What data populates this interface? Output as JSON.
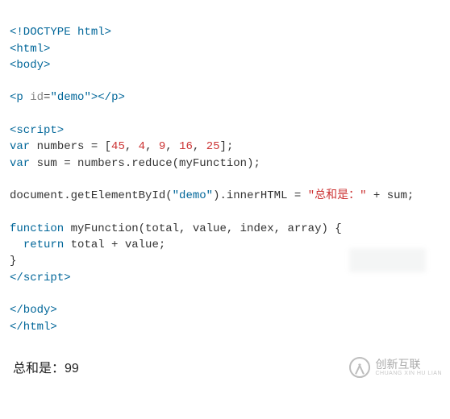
{
  "code": {
    "line1": {
      "open": "<!DOCTYPE",
      "rest": " html>"
    },
    "line2": {
      "open": "<html>"
    },
    "line3": {
      "open": "<body>"
    },
    "blank4": "",
    "line5": {
      "open": "<p ",
      "attr": "id",
      "eq": "=",
      "val": "\"demo\"",
      "mid": ">",
      "close": "</p>"
    },
    "blank6": "",
    "line7": {
      "open": "<script>"
    },
    "line8": {
      "kw": "var",
      "lhs": " numbers = [",
      "n1": "45",
      "c1": ", ",
      "n2": "4",
      "c2": ", ",
      "n3": "9",
      "c3": ", ",
      "n4": "16",
      "c4": ", ",
      "n5": "25",
      "tail": "];"
    },
    "line9": {
      "kw": "var",
      "rest": " sum = numbers.reduce(myFunction);"
    },
    "blank10": "",
    "line11": {
      "pre": "document.getElementById(",
      "arg": "\"demo\"",
      "mid": ").innerHTML = ",
      "lit": "\"总和是：\"",
      "post": " + sum;"
    },
    "blank12": "",
    "line13": {
      "kw": "function",
      "rest": " myFunction(total, value, index, array) {"
    },
    "line14": {
      "indent": "  ",
      "kw": "return",
      "rest": " total + value;"
    },
    "line15": {
      "brace": "}"
    },
    "line16": {
      "close": "</",
      "name": "script",
      "gt": ">"
    },
    "blank17": "",
    "line18": {
      "close": "</body>"
    },
    "line19": {
      "close": "</html>"
    }
  },
  "output": {
    "text": "总和是：99"
  },
  "watermark": {
    "brand": "创新互联",
    "sub": "CHUANG XIN HU LIAN"
  }
}
